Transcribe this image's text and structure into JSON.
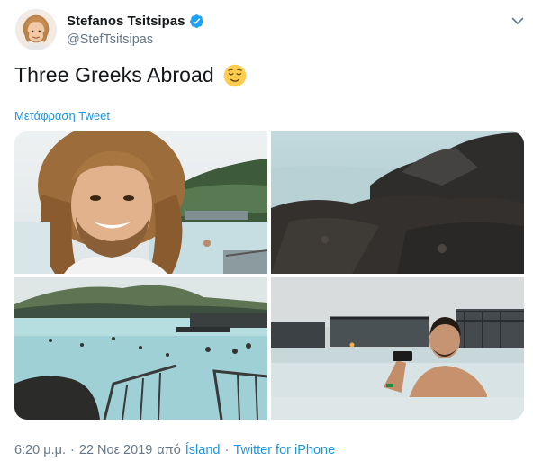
{
  "user": {
    "name": "Stefanos Tsitsipas",
    "handle": "@StefTsitsipas",
    "verified": true,
    "avatar_icon": "memoji-avatar-icon"
  },
  "tweet": {
    "text": "Three Greeks Abroad",
    "emoji": "relieved-face-emoji",
    "translate_label": "Μετάφραση Tweet"
  },
  "media": {
    "count": 4,
    "photos": [
      {
        "subject": "selfie-at-hot-spring"
      },
      {
        "subject": "lava-rocks-by-water"
      },
      {
        "subject": "blue-lagoon-bathers"
      },
      {
        "subject": "man-in-lagoon-with-phone"
      }
    ]
  },
  "meta": {
    "time": "6:20 μ.μ.",
    "date": "22 Νοε 2019",
    "from_word": "από",
    "place": "Ísland",
    "separator": "·",
    "source": "Twitter for iPhone"
  },
  "colors": {
    "link": "#1b95e0",
    "secondary_text": "#657786",
    "verified_badge": "#1da1f2"
  }
}
